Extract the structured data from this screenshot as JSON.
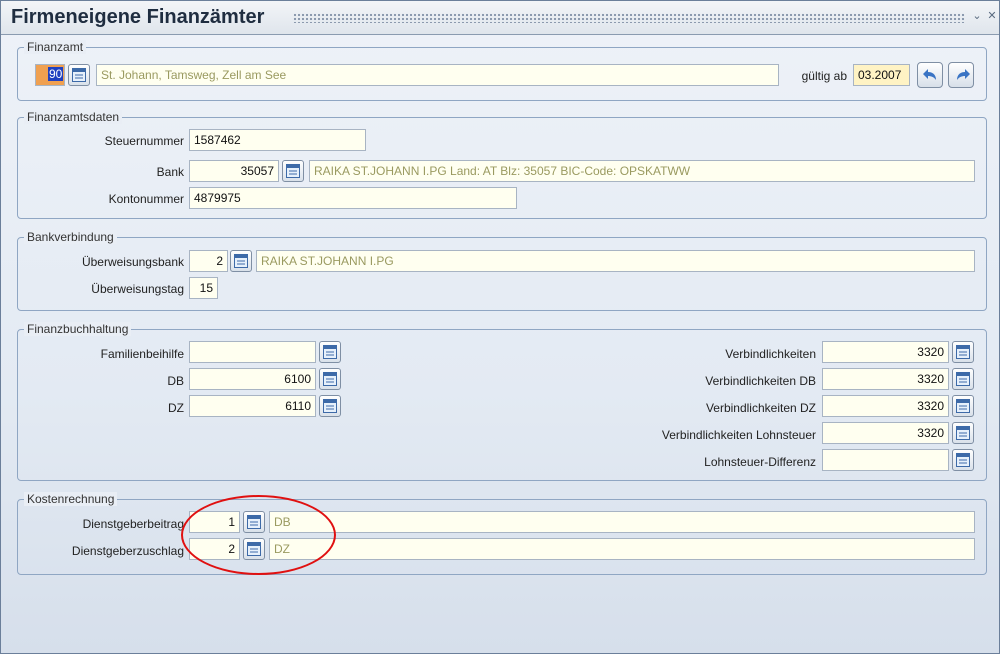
{
  "window": {
    "title": "Firmeneigene Finanzämter"
  },
  "finanzamt": {
    "legend": "Finanzamt",
    "code": "90",
    "name": "St. Johann, Tamsweg, Zell am See",
    "valid_label": "gültig ab",
    "valid_from": "03.2007"
  },
  "finanzamtsdaten": {
    "legend": "Finanzamtsdaten",
    "steuernummer_label": "Steuernummer",
    "steuernummer": "1587462",
    "bank_label": "Bank",
    "bank_code": "35057",
    "bank_desc": "RAIKA ST.JOHANN I.PG Land: AT Blz: 35057 BIC-Code: OPSKATWW",
    "kontonummer_label": "Kontonummer",
    "kontonummer": "4879975"
  },
  "bankverbindung": {
    "legend": "Bankverbindung",
    "ueberweisungsbank_label": "Überweisungsbank",
    "ueberweisungsbank": "2",
    "ueberweisungsbank_desc": "RAIKA ST.JOHANN I.PG",
    "ueberweisungstag_label": "Überweisungstag",
    "ueberweisungstag": "15"
  },
  "finanzbuchhaltung": {
    "legend": "Finanzbuchhaltung",
    "familienbeihilfe_label": "Familienbeihilfe",
    "familienbeihilfe": "",
    "db_label": "DB",
    "db": "6100",
    "dz_label": "DZ",
    "dz": "6110",
    "verbindlichkeiten_label": "Verbindlichkeiten",
    "verbindlichkeiten": "3320",
    "verbindlichkeiten_db_label": "Verbindlichkeiten DB",
    "verbindlichkeiten_db": "3320",
    "verbindlichkeiten_dz_label": "Verbindlichkeiten DZ",
    "verbindlichkeiten_dz": "3320",
    "verbindlichkeiten_lst_label": "Verbindlichkeiten Lohnsteuer",
    "verbindlichkeiten_lst": "3320",
    "lohnsteuer_diff_label": "Lohnsteuer-Differenz",
    "lohnsteuer_diff": ""
  },
  "kostenrechnung": {
    "legend": "Kostenrechnung",
    "dienstgeberbeitrag_label": "Dienstgeberbeitrag",
    "dienstgeberbeitrag": "1",
    "dienstgeberbeitrag_desc": "DB",
    "dienstgeberzuschlag_label": "Dienstgeberzuschlag",
    "dienstgeberzuschlag": "2",
    "dienstgeberzuschlag_desc": "DZ"
  },
  "icons": {
    "lookup": "list-lookup-icon",
    "back": "arrow-back-icon",
    "forward": "arrow-forward-icon",
    "restore": "restore-icon",
    "close": "close-icon"
  },
  "colors": {
    "code_highlight": "#f0a050",
    "selection": "#2040c0",
    "annotation": "#e01010"
  }
}
